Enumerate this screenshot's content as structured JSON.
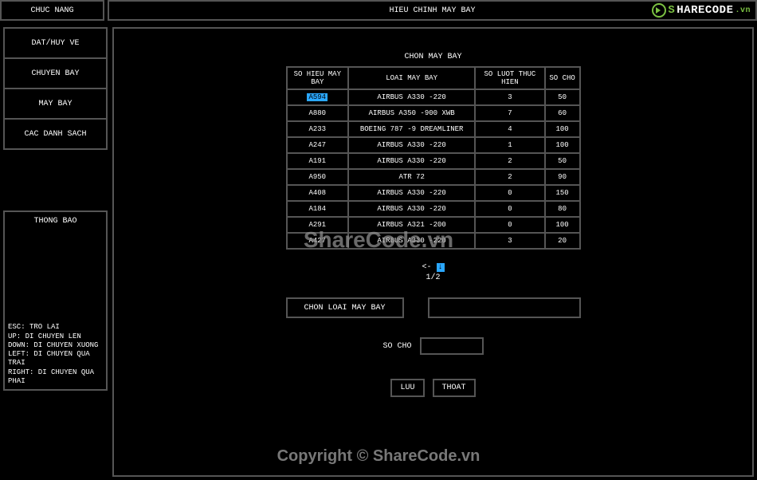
{
  "top": {
    "left_label": "CHUC NANG",
    "right_label": "HIEU CHINH MAY BAY"
  },
  "sidebar": {
    "items": [
      {
        "label": "DAT/HUY VE"
      },
      {
        "label": "CHUYEN BAY"
      },
      {
        "label": "MAY BAY"
      },
      {
        "label": "CAC DANH SACH"
      }
    ]
  },
  "thongbao": {
    "title": "THONG BAO",
    "help": [
      "ESC: TRO LAI",
      "UP: DI CHUYEN LEN",
      "DOWN: DI CHUYEN XUONG",
      "LEFT: DI CHUYEN QUA TRAI",
      "RIGHT: DI CHUYEN QUA PHAI"
    ]
  },
  "main": {
    "title": "CHON MAY BAY",
    "headers": [
      "SO HIEU MAY BAY",
      "LOAI MAY BAY",
      "SO LUOT THUC HIEN",
      "SO CHO"
    ],
    "rows": [
      {
        "id": "A594",
        "loai": "AIRBUS A330 -220",
        "luot": "3",
        "cho": "50",
        "selected": true
      },
      {
        "id": "A880",
        "loai": "AIRBUS A350 -900 XWB",
        "luot": "7",
        "cho": "60"
      },
      {
        "id": "A233",
        "loai": "BOEING 787 -9 DREAMLINER",
        "luot": "4",
        "cho": "100"
      },
      {
        "id": "A247",
        "loai": "AIRBUS A330 -220",
        "luot": "1",
        "cho": "100"
      },
      {
        "id": "A191",
        "loai": "AIRBUS A330 -220",
        "luot": "2",
        "cho": "50"
      },
      {
        "id": "A950",
        "loai": "ATR 72",
        "luot": "2",
        "cho": "90"
      },
      {
        "id": "A408",
        "loai": "AIRBUS A330 -220",
        "luot": "0",
        "cho": "150"
      },
      {
        "id": "A184",
        "loai": "AIRBUS A330 -220",
        "luot": "0",
        "cho": "80"
      },
      {
        "id": "A291",
        "loai": "AIRBUS A321 -200",
        "luot": "0",
        "cho": "100"
      },
      {
        "id": "A427",
        "loai": "AIRBUS A330 -220",
        "luot": "3",
        "cho": "20"
      }
    ],
    "pager": {
      "arrow": "<-",
      "hint": "↓",
      "page": "1/2"
    },
    "choose_label": "CHON LOAI MAY BAY",
    "socho_label": "SO CHO",
    "buttons": {
      "save": "LUU",
      "exit": "THOAT"
    }
  },
  "watermark": {
    "logo_s": "S",
    "logo_rest": "HARECODE",
    "logo_vn": ".vn",
    "center": "ShareCode.vn",
    "bottom": "Copyright © ShareCode.vn"
  }
}
